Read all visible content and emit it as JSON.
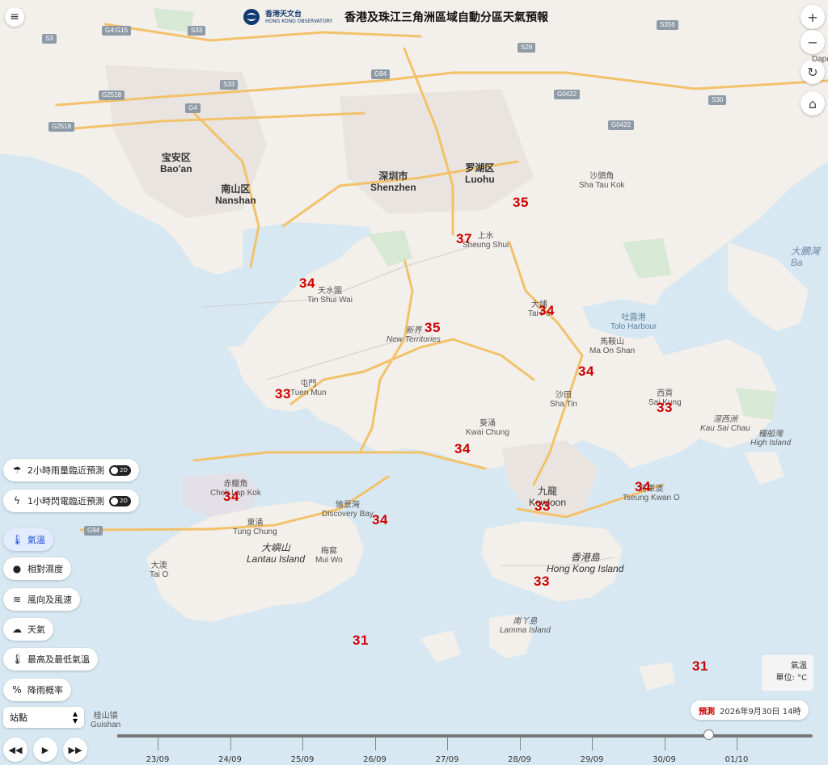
{
  "header": {
    "logo_zh": "香港天文台",
    "logo_en": "HONG KONG OBSERVATORY",
    "title": "香港及珠江三角洲區域自動分區天氣預報"
  },
  "controls": {
    "menu": "≡",
    "zoom_in": "+",
    "zoom_out": "−",
    "refresh": "↻",
    "home": "⌂"
  },
  "places": [
    {
      "name": "sheung-shui",
      "zh": "上水",
      "en": "Sheung Shui"
    },
    {
      "name": "tin-shui-wai",
      "zh": "天水圍",
      "en": "Tin Shui Wai"
    },
    {
      "name": "new-territories",
      "zh": "新界",
      "en": "New Territories"
    },
    {
      "name": "tai-po",
      "zh": "大埔",
      "en": "Tai Po"
    },
    {
      "name": "tolo-harbour",
      "zh": "吐露港",
      "en": "Tolo Harbour"
    },
    {
      "name": "ma-on-shan",
      "zh": "馬鞍山",
      "en": "Ma On Shan"
    },
    {
      "name": "tuen-mun",
      "zh": "屯門",
      "en": "Tuen Mun"
    },
    {
      "name": "sha-tin",
      "zh": "沙田",
      "en": "Sha Tin"
    },
    {
      "name": "sai-kung",
      "zh": "西貢",
      "en": "Sai Kung"
    },
    {
      "name": "kau-sai-chau",
      "zh": "滘西洲",
      "en": "Kau Sai Chau"
    },
    {
      "name": "high-island",
      "zh": "糧船灣",
      "en": "High Island"
    },
    {
      "name": "kwai-chung",
      "zh": "葵涌",
      "en": "Kwai Chung"
    },
    {
      "name": "chek-lap-kok",
      "zh": "赤鱲角",
      "en": "Chek Lap Kok"
    },
    {
      "name": "kowloon",
      "zh": "九龍",
      "en": "Kowloon"
    },
    {
      "name": "tseung-kwan-o",
      "zh": "將軍澳",
      "en": "Tseung Kwan O"
    },
    {
      "name": "discovery-bay",
      "zh": "愉景灣",
      "en": "Discovery Bay"
    },
    {
      "name": "tung-chung",
      "zh": "東涌",
      "en": "Tung Chung"
    },
    {
      "name": "lantau-island",
      "zh": "大嶼山",
      "en": "Lantau Island"
    },
    {
      "name": "mui-wo",
      "zh": "梅窩",
      "en": "Mui Wo"
    },
    {
      "name": "hong-kong-island",
      "zh": "香港島",
      "en": "Hong Kong Island"
    },
    {
      "name": "tai-o",
      "zh": "大澳",
      "en": "Tai O"
    },
    {
      "name": "lamma-island",
      "zh": "南丫島",
      "en": "Lamma Island"
    },
    {
      "name": "bao-an",
      "zh": "宝安区",
      "en": "Bao'an"
    },
    {
      "name": "nanshan",
      "zh": "南山区",
      "en": "Nanshan"
    },
    {
      "name": "shenzhen",
      "zh": "深圳市",
      "en": "Shenzhen"
    },
    {
      "name": "luohu",
      "zh": "罗湖区",
      "en": "Luohu"
    },
    {
      "name": "sha-tau-kok",
      "zh": "沙頭角",
      "en": "Sha Tau Kok"
    },
    {
      "name": "guishan",
      "zh": "桂山镇",
      "en": "Guishan"
    },
    {
      "name": "mirs-bay",
      "zh": "大鵬灣",
      "en": "Ba"
    },
    {
      "name": "dapeng",
      "zh": "",
      "en": "Dape"
    }
  ],
  "roads": [
    "S3",
    "G4:G15",
    "S33",
    "G2518",
    "S33",
    "G4",
    "G2518",
    "G94",
    "S28",
    "G0422",
    "G0422",
    "S356",
    "S30",
    "G94",
    "G15",
    "G15"
  ],
  "temperatures": [
    {
      "name": "temp-luohu",
      "value": "35"
    },
    {
      "name": "temp-sheung-shui",
      "value": "37"
    },
    {
      "name": "temp-tin-shui-wai",
      "value": "34"
    },
    {
      "name": "temp-tai-po",
      "value": "34"
    },
    {
      "name": "temp-new-territories",
      "value": "35"
    },
    {
      "name": "temp-ma-on-shan",
      "value": "34"
    },
    {
      "name": "temp-tuen-mun",
      "value": "33"
    },
    {
      "name": "temp-sai-kung",
      "value": "33"
    },
    {
      "name": "temp-kwai-chung",
      "value": "34"
    },
    {
      "name": "temp-chek-lap-kok",
      "value": "34"
    },
    {
      "name": "temp-tseung-kwan-o",
      "value": "34"
    },
    {
      "name": "temp-discovery-bay",
      "value": "34"
    },
    {
      "name": "temp-kowloon",
      "value": "33"
    },
    {
      "name": "temp-hong-kong-island",
      "value": "33"
    },
    {
      "name": "temp-lamma",
      "value": "31"
    },
    {
      "name": "temp-southeast-sea",
      "value": "31"
    }
  ],
  "panel": {
    "rain_nowcast": "2小時雨量臨近預測",
    "lightning_nowcast": "1小時閃電臨近預測",
    "toggle_2d": "2D",
    "temperature": "氣溫",
    "humidity": "相對濕度",
    "wind": "風向及風速",
    "weather": "天氣",
    "max_min_temp": "最高及最低氣溫",
    "rain_probability": "降雨概率",
    "station_select": "站點"
  },
  "legend": {
    "line1": "氣溫",
    "line2": "單位: °C"
  },
  "forecast": {
    "label": "預測",
    "time": "2026年9月30日 14時"
  },
  "timeline": {
    "dates": [
      "23/09",
      "24/09",
      "25/09",
      "26/09",
      "27/09",
      "28/09",
      "29/09",
      "30/09",
      "01/10"
    ],
    "progress": 0.85
  },
  "colors": {
    "temperature": "#cc0000",
    "water": "#d7e8f2",
    "land": "#f3efea",
    "road": "#f2c26b",
    "accent": "#1e4fd6"
  }
}
